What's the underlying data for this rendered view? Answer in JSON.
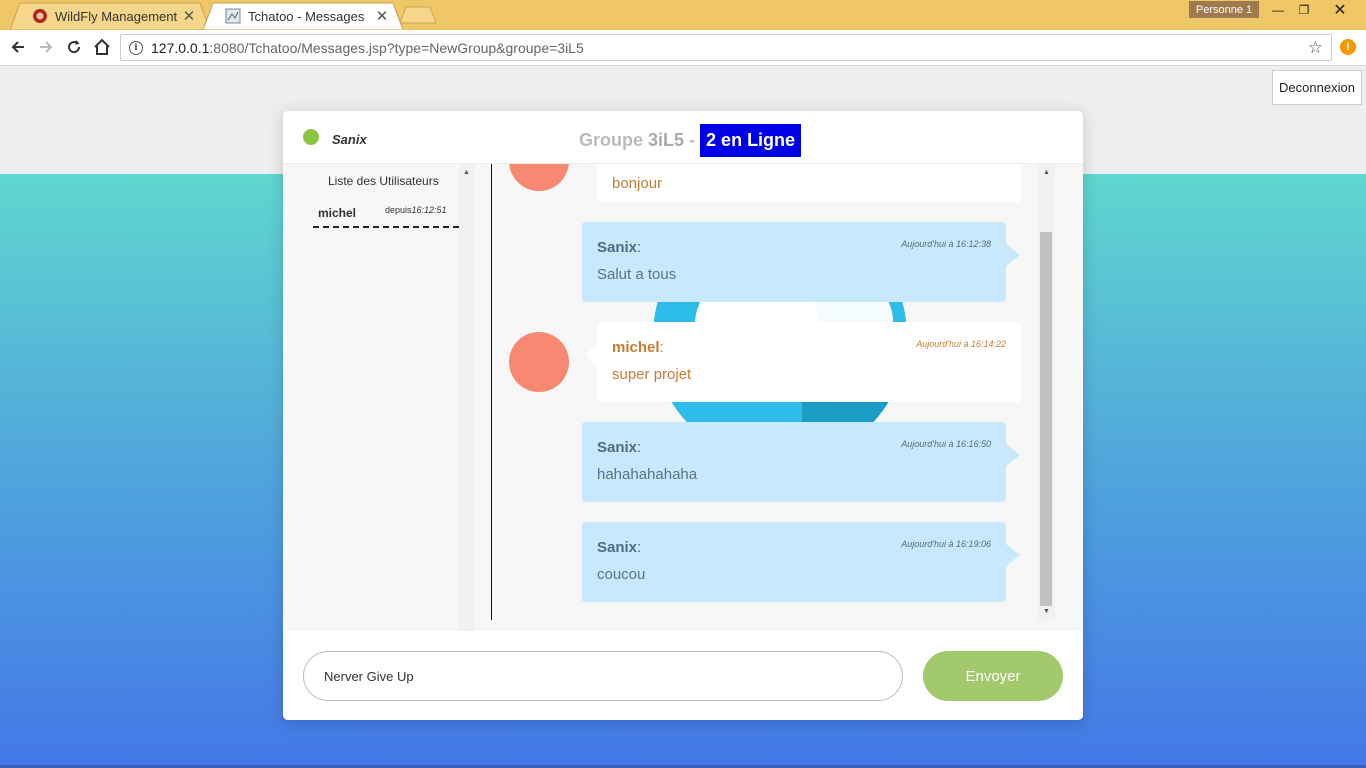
{
  "browser": {
    "tabs": [
      {
        "label": "WildFly Management",
        "icon": "wildfly-icon"
      },
      {
        "label": "Tchatoo - Messages",
        "icon": "page-icon"
      }
    ],
    "profile": "Personne 1",
    "url_host": "127.0.0.1",
    "url_rest": ":8080/Tchatoo/Messages.jsp?type=NewGroup&groupe=3iL5"
  },
  "page": {
    "logout_label": "Deconnexion"
  },
  "chat": {
    "current_user": "Sanix",
    "group_prefix": "Groupe",
    "group_name": "3iL5",
    "group_sep": "-",
    "online_label": "2 en Ligne",
    "sidebar_title": "Liste des Utilisateurs",
    "users": [
      {
        "name": "michel",
        "since_label": "depuis",
        "since_time": "16:12:51"
      }
    ],
    "messages": [
      {
        "author": "",
        "text": "bonjour",
        "time": "",
        "type": "other"
      },
      {
        "author": "Sanix",
        "text": "Salut a tous",
        "time": "Aujourd'hui à 16:12:38",
        "type": "self"
      },
      {
        "author": "michel",
        "text": "super projet",
        "time": "Aujourd'hui à 16:14:22",
        "type": "other"
      },
      {
        "author": "Sanix",
        "text": "hahahahahaha",
        "time": "Aujourd'hui à 16:16:50",
        "type": "self"
      },
      {
        "author": "Sanix",
        "text": "coucou",
        "time": "Aujourd'hui à 16:19:06",
        "type": "self"
      }
    ],
    "input_value": "Nerver Give Up",
    "send_label": "Envoyer"
  },
  "colors": {
    "accent_online": "#0000e6",
    "send_button": "#a2c96b",
    "self_bubble": "#c8e9fb",
    "avatar": "#f78871",
    "status_online": "#8dc63f"
  }
}
